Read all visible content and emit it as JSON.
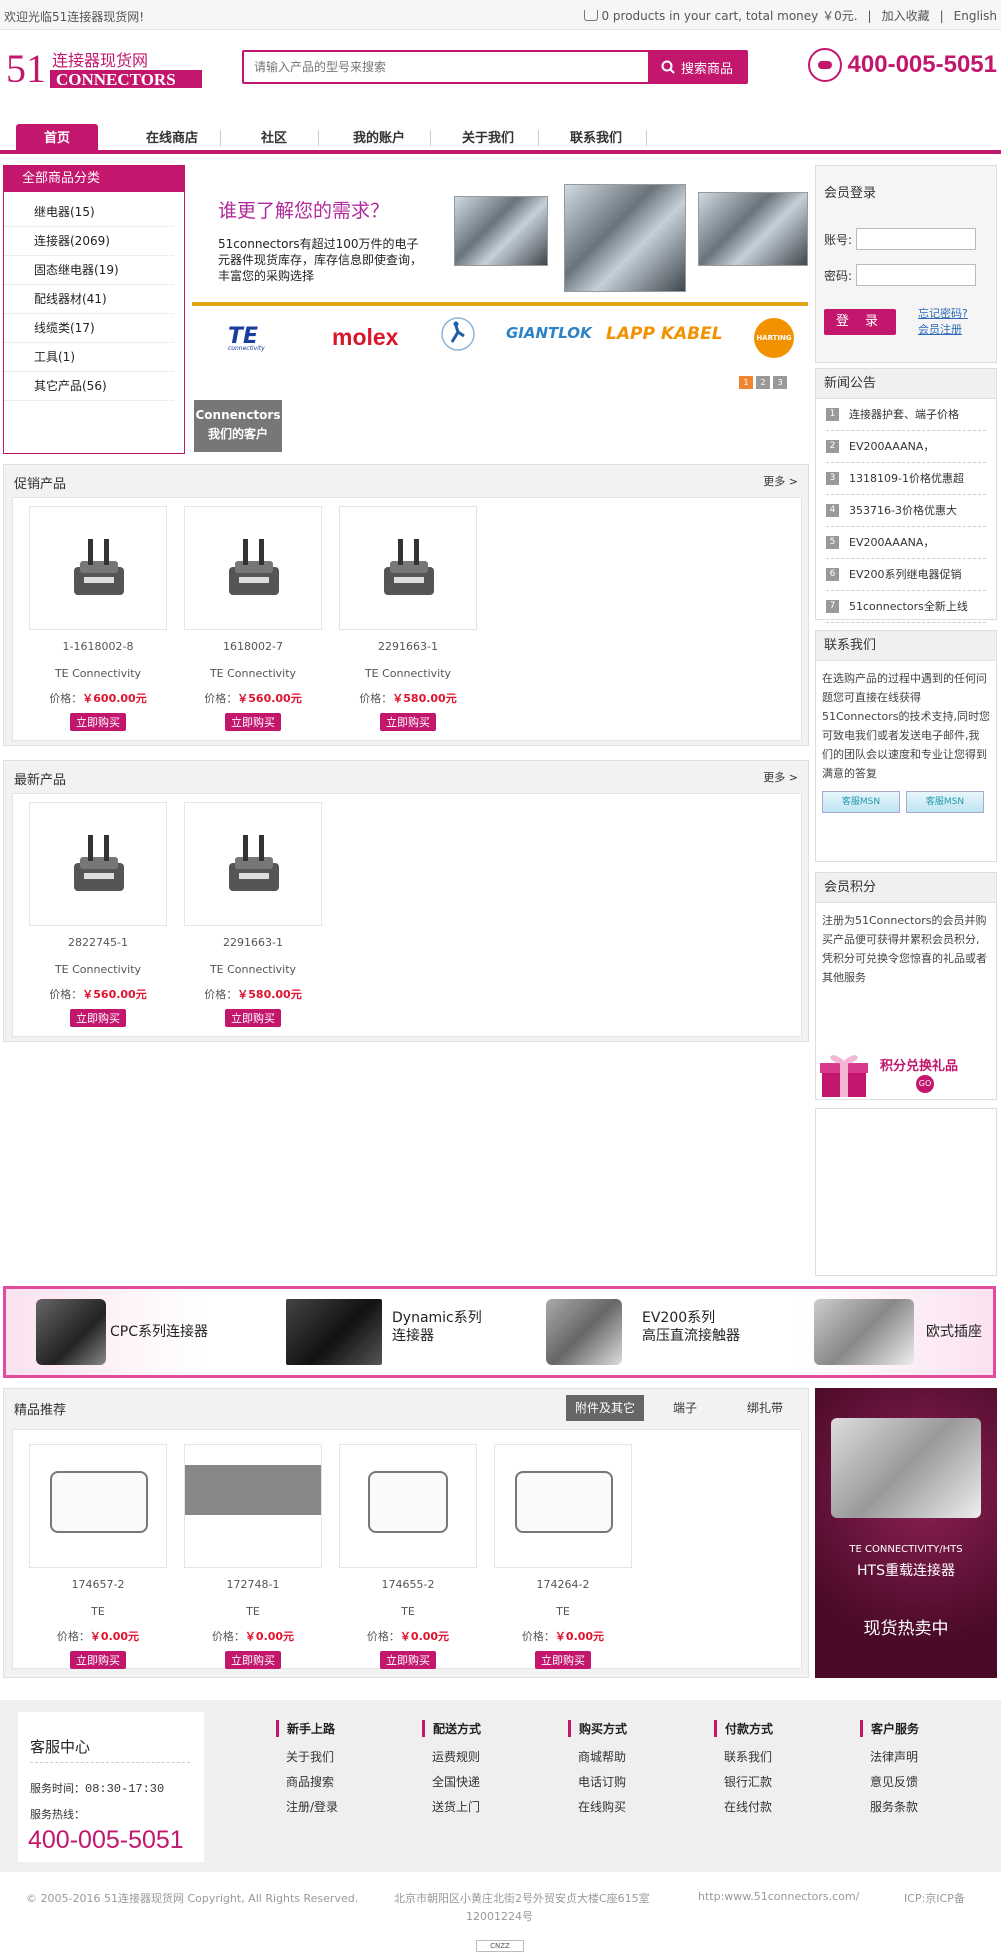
{
  "topbar": {
    "welcome": "欢迎光临51连接器现货网!",
    "cart": "0 products in your cart, total money ￥0元.",
    "favorite": "加入收藏",
    "lang": "English"
  },
  "header": {
    "logo_cn": "连接器现货网",
    "logo_en": "CONNECTORS",
    "logo_num": "51",
    "search_placeholder": "请输入产品的型号来搜索",
    "search_button": "搜索商品",
    "phone": "400-005-5051"
  },
  "nav": [
    "首页",
    "在线商店",
    "社区",
    "我的账户",
    "关于我们",
    "联系我们"
  ],
  "categories": {
    "title": "全部商品分类",
    "items": [
      "继电器(15)",
      "连接器(2069)",
      "固态继电器(19)",
      "配线器材(41)",
      "线缆类(17)",
      "工具(1)",
      "其它产品(56)"
    ]
  },
  "banner": {
    "title": "谁更了解您的需求？",
    "desc": "51connectors有超过100万件的电子元器件现货库存，库存信息即使查询，丰富您的采购选择",
    "brands": [
      "TE",
      "connectivity",
      "molex",
      "GIANTLOK",
      "LAPP KABEL",
      "HARTING"
    ],
    "pages": [
      "1",
      "2",
      "3"
    ],
    "customer_tag": "Connenctors",
    "customer_tag2": "我们的客户"
  },
  "promo": {
    "title": "促销产品",
    "more": "更多 >",
    "items": [
      {
        "code": "1-1618002-8",
        "brand": "TE Connectivity",
        "price_label": "价格：",
        "price": "￥600.00元",
        "buy": "立即购买"
      },
      {
        "code": "1618002-7",
        "brand": "TE Connectivity",
        "price_label": "价格：",
        "price": "￥560.00元",
        "buy": "立即购买"
      },
      {
        "code": "2291663-1",
        "brand": "TE Connectivity",
        "price_label": "价格：",
        "price": "￥580.00元",
        "buy": "立即购买"
      }
    ]
  },
  "newest": {
    "title": "最新产品",
    "more": "更多 >",
    "items": [
      {
        "code": "2822745-1",
        "brand": "TE Connectivity",
        "price_label": "价格：",
        "price": "￥560.00元",
        "buy": "立即购买"
      },
      {
        "code": "2291663-1",
        "brand": "TE Connectivity",
        "price_label": "价格：",
        "price": "￥580.00元",
        "buy": "立即购买"
      }
    ]
  },
  "login": {
    "title": "会员登录",
    "account": "账号:",
    "password": "密码:",
    "button": "登 录",
    "forgot": "忘记密码?",
    "register": "会员注册"
  },
  "news": {
    "title": "新闻公告",
    "items": [
      "连接器护套、端子价格",
      "EV200AAANA，",
      "1318109-1价格优惠超",
      "353716-3价格优惠大",
      "EV200AAANA，",
      "EV200系列继电器促销",
      "51connectors全新上线"
    ]
  },
  "contact": {
    "title": "联系我们",
    "text": "在选购产品的过程中遇到的任何问题您可直接在线获得51Connectors的技术支持,同时您可致电我们或者发送电子邮件,我们的团队会以速度和专业让您得到满意的答复",
    "qq": [
      "客服MSN",
      "客服MSN"
    ]
  },
  "points": {
    "title": "会员积分",
    "text": "注册为51Connectors的会员并购买产品便可获得并累积会员积分,凭积分可兑换令您惊喜的礼品或者其他服务",
    "exchange": "积分兑换礼品",
    "go": "GO"
  },
  "strip": [
    {
      "label": "CPC系列连接器"
    },
    {
      "label": "Dynamic系列\n连接器"
    },
    {
      "label": "EV200系列\n高压直流接触器"
    },
    {
      "label": "欧式插座"
    }
  ],
  "featured": {
    "title": "精品推荐",
    "tabs": [
      "附件及其它",
      "端子",
      "绑扎带"
    ],
    "items": [
      {
        "code": "174657-2",
        "brand": "TE",
        "price_label": "价格：",
        "price": "￥0.00元",
        "buy": "立即购买"
      },
      {
        "code": "172748-1",
        "brand": "TE",
        "price_label": "价格：",
        "price": "￥0.00元",
        "buy": "立即购买"
      },
      {
        "code": "174655-2",
        "brand": "TE",
        "price_label": "价格：",
        "price": "￥0.00元",
        "buy": "立即购买"
      },
      {
        "code": "174264-2",
        "brand": "TE",
        "price_label": "价格：",
        "price": "￥0.00元",
        "buy": "立即购买"
      }
    ],
    "hts_line1": "TE CONNECTIVITY/HTS",
    "hts_line2": "HTS重载连接器",
    "hts_line3": "现货热卖中"
  },
  "footer": {
    "service_title": "客服中心",
    "hours_label": "服务时间：",
    "hours": "08:30-17:30",
    "hotline_label": "服务热线：",
    "hotline": "400-005-5051",
    "cols": [
      {
        "h": "新手上路",
        "links": [
          "关于我们",
          "商品搜索",
          "注册/登录"
        ]
      },
      {
        "h": "配送方式",
        "links": [
          "运费规则",
          "全国快递",
          "送货上门"
        ]
      },
      {
        "h": "购买方式",
        "links": [
          "商城帮助",
          "电话订购",
          "在线购买"
        ]
      },
      {
        "h": "付款方式",
        "links": [
          "联系我们",
          "银行汇款",
          "在线付款"
        ]
      },
      {
        "h": "客户服务",
        "links": [
          "法律声明",
          "意见反馈",
          "服务条款"
        ]
      }
    ],
    "copyright": "© 2005-2016 51连接器现货网 Copyright, All Rights Reserved.",
    "address": "北京市朝阳区小黄庄北街2号外贸安贞大楼C座615室",
    "address2": "12001224号",
    "url": "http:www.51connectors.com/",
    "icp": "ICP:京ICP备",
    "badge": "CNZZ"
  },
  "colors": {
    "brand": "#c2176d",
    "price": "#e0122e"
  }
}
